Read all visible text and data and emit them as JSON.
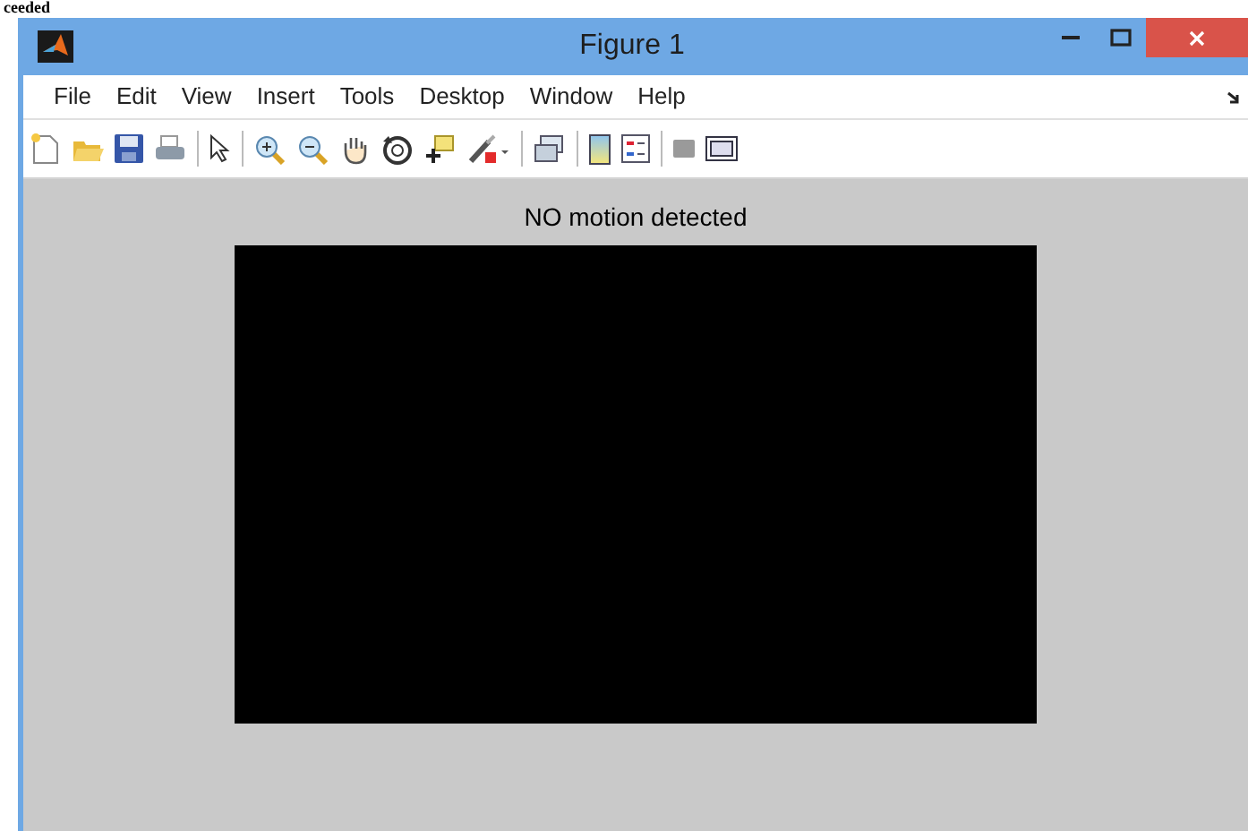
{
  "page_fragment": "ceeded",
  "window": {
    "title": "Figure 1"
  },
  "menu": [
    "File",
    "Edit",
    "View",
    "Insert",
    "Tools",
    "Desktop",
    "Window",
    "Help"
  ],
  "figure": {
    "title": "NO motion detected"
  }
}
